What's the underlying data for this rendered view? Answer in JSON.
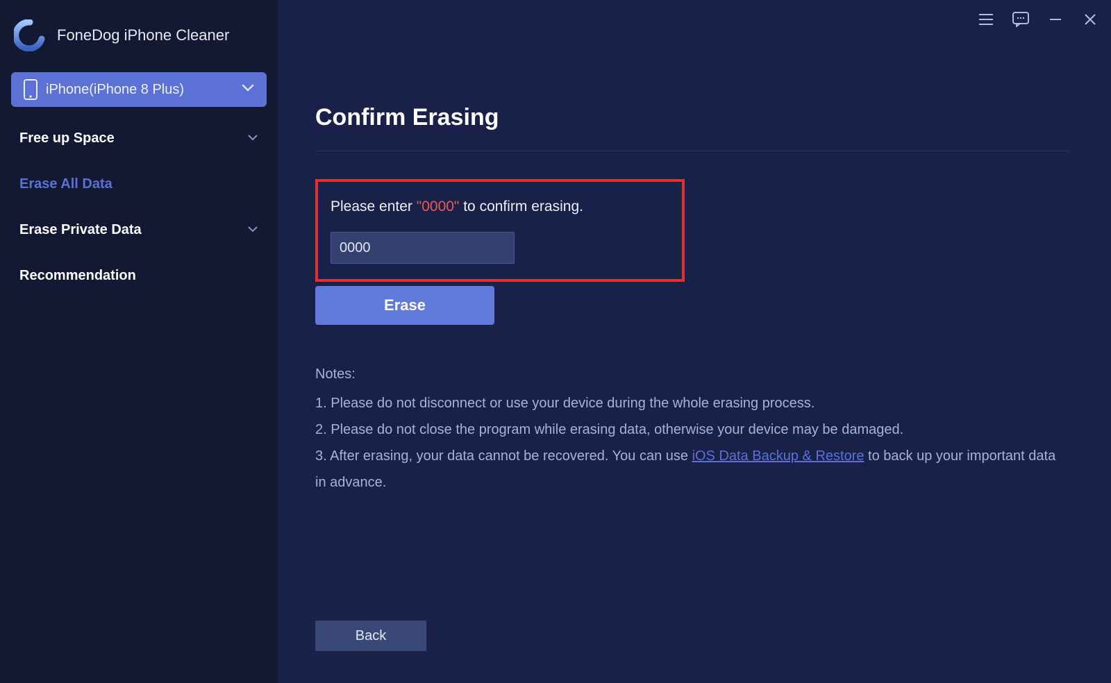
{
  "app": {
    "title": "FoneDog iPhone Cleaner"
  },
  "device": {
    "label": "iPhone(iPhone 8 Plus)"
  },
  "sidebar": {
    "items": [
      {
        "label": "Free up Space",
        "active": false,
        "expandable": true
      },
      {
        "label": "Erase All Data",
        "active": true,
        "expandable": false
      },
      {
        "label": "Erase Private Data",
        "active": false,
        "expandable": true
      },
      {
        "label": "Recommendation",
        "active": false,
        "expandable": false
      }
    ]
  },
  "page": {
    "title": "Confirm Erasing",
    "instruction_prefix": "Please enter ",
    "instruction_code": "\"0000\"",
    "instruction_suffix": " to confirm erasing.",
    "input_value": "0000",
    "erase_label": "Erase",
    "back_label": "Back"
  },
  "notes": {
    "heading": "Notes:",
    "line1": "1. Please do not disconnect or use your device during the whole erasing process.",
    "line2": "2. Please do not close the program while erasing data, otherwise your device may be damaged.",
    "line3_prefix": "3. After erasing, your data cannot be recovered. You can use ",
    "line3_link": "iOS Data Backup & Restore",
    "line3_suffix": " to back up your important data in advance."
  }
}
